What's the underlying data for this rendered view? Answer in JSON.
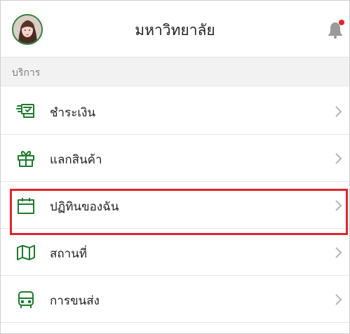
{
  "header": {
    "title": "มหาวิทยาลัย"
  },
  "section": {
    "label": "บริการ"
  },
  "menu": [
    {
      "label": "ชำระเงิน",
      "icon": "payment-icon"
    },
    {
      "label": "แลกสินค้า",
      "icon": "gift-icon"
    },
    {
      "label": "ปฏิทินของฉัน",
      "icon": "calendar-icon"
    },
    {
      "label": "สถานที่",
      "icon": "map-icon"
    },
    {
      "label": "การขนส่ง",
      "icon": "bus-icon"
    }
  ],
  "colors": {
    "accent": "#1e7a2e",
    "highlight": "#e0242b",
    "notification": "#e0242b"
  }
}
